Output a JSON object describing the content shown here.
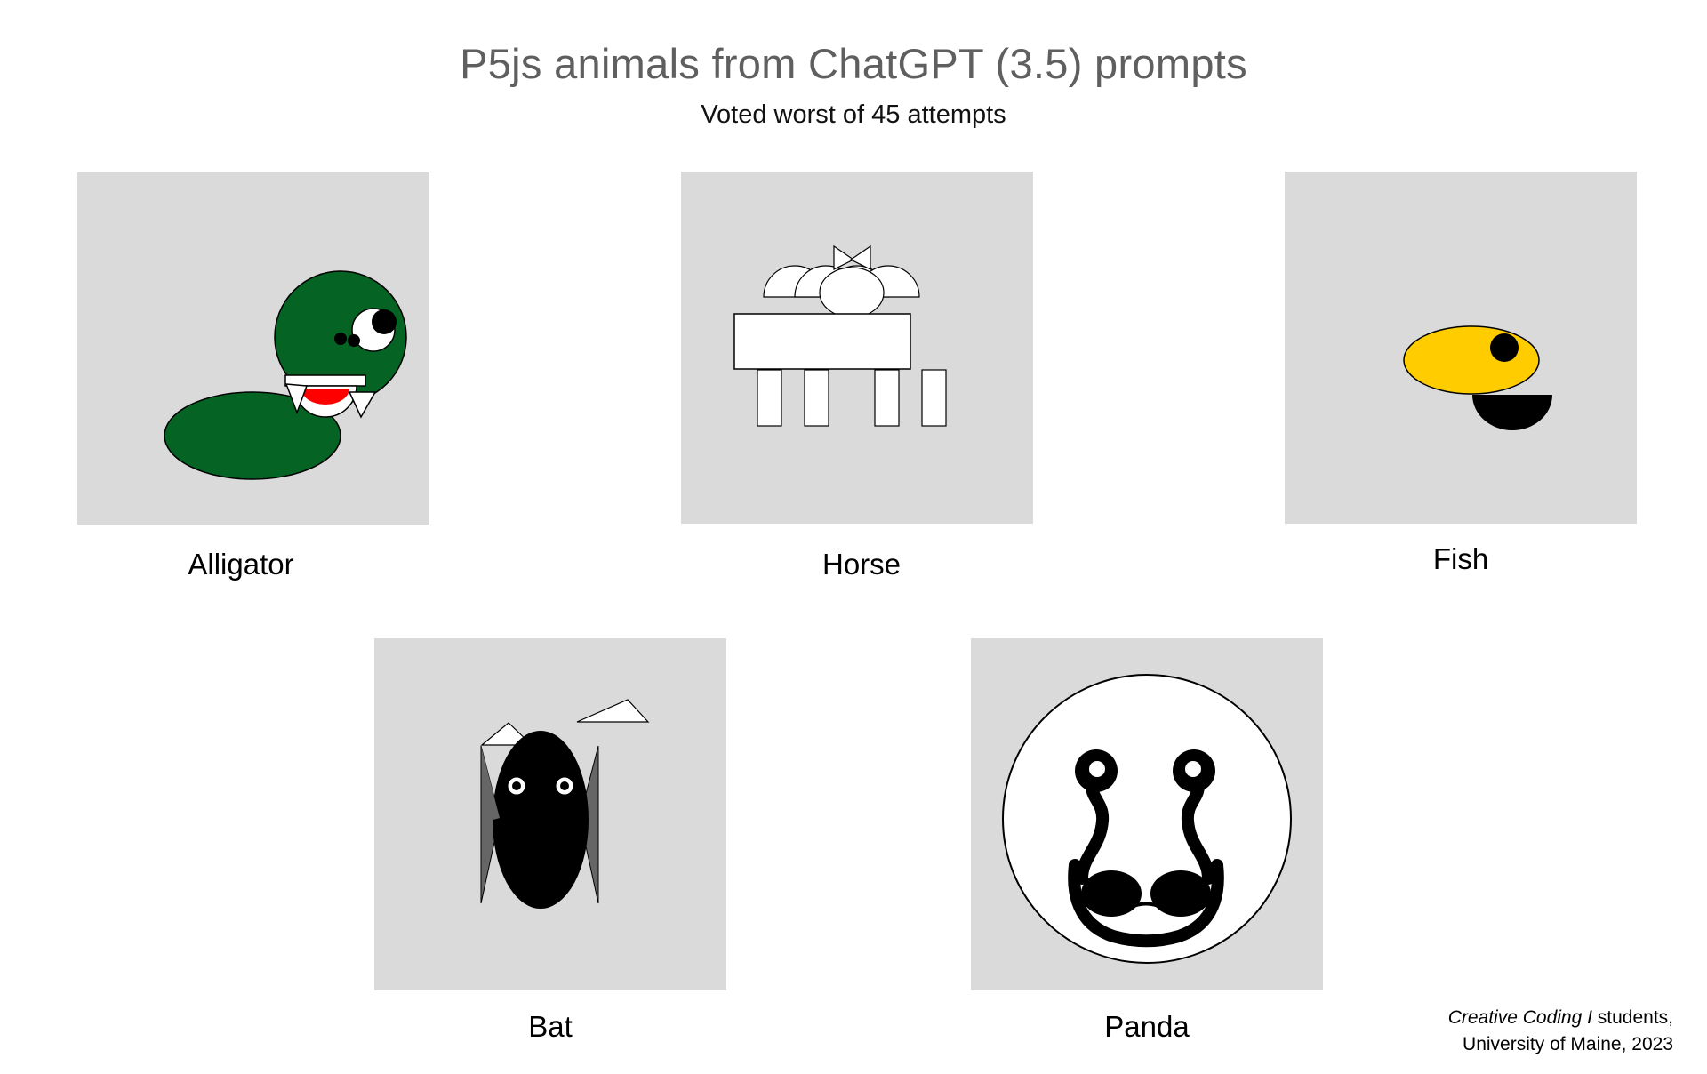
{
  "header": {
    "title": "P5js animals from ChatGPT (3.5) prompts",
    "subtitle": "Voted worst of 45 attempts"
  },
  "animals": [
    {
      "label": "Alligator",
      "icon": "alligator-drawing",
      "color": "#056323"
    },
    {
      "label": "Horse",
      "icon": "horse-drawing",
      "color": "#ffffff"
    },
    {
      "label": "Fish",
      "icon": "fish-drawing",
      "color": "#ffcc00"
    },
    {
      "label": "Bat",
      "icon": "bat-drawing",
      "color": "#000000"
    },
    {
      "label": "Panda",
      "icon": "panda-drawing",
      "color": "#000000"
    }
  ],
  "credit": {
    "course": "Creative Coding I",
    "line1_rest": " students,",
    "line2": "University of Maine, 2023"
  },
  "colors": {
    "panel_background": "#dadada",
    "title_color": "#5f5f5f",
    "alligator_green": "#056323",
    "alligator_mouth": "#ff0000",
    "fish_yellow": "#ffcc00",
    "bat_wing_gray": "#666666"
  }
}
